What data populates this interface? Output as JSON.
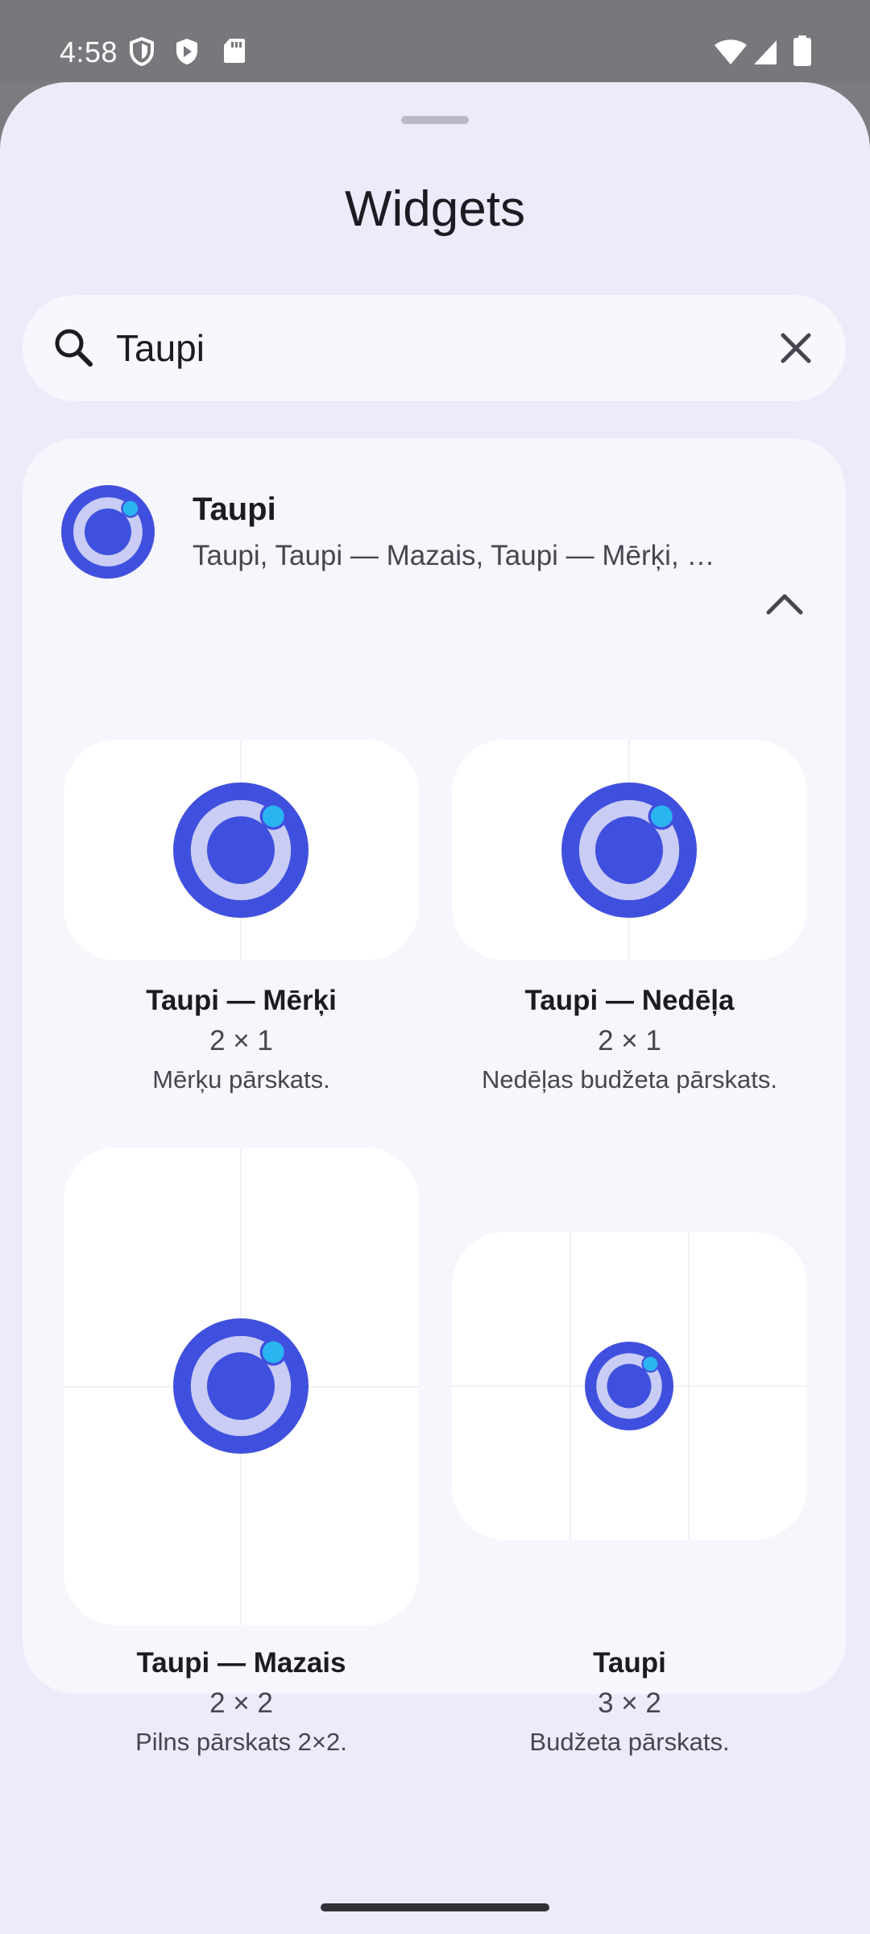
{
  "status_bar": {
    "time": "4:58",
    "icons_left": [
      "shield-icon",
      "play-protect-icon",
      "sd-card-icon"
    ],
    "icons_right": [
      "wifi-icon",
      "signal-icon",
      "battery-icon"
    ]
  },
  "sheet": {
    "title": "Widgets"
  },
  "search": {
    "value": "Taupi",
    "icon": "search-icon",
    "clear_icon": "close-icon"
  },
  "app": {
    "name": "Taupi",
    "subtitle": "Taupi, Taupi — Mazais, Taupi — Mērķi, …",
    "expand_icon": "chevron-up-icon",
    "brand_colors": {
      "ring": "#4050de",
      "ring_inner": "#c9cdf5",
      "dot": "#2ab5f0"
    }
  },
  "widgets": [
    {
      "name": "Taupi — Mērķi",
      "size": "2 × 1",
      "description": "Mērķu pārskats."
    },
    {
      "name": "Taupi — Nedēļa",
      "size": "2 × 1",
      "description": "Nedēļas budžeta pārskats."
    },
    {
      "name": "Taupi — Mazais",
      "size": "2 × 2",
      "description": "Pilns pārskats 2×2."
    },
    {
      "name": "Taupi",
      "size": "3 × 2",
      "description": "Budžeta pārskats."
    }
  ]
}
